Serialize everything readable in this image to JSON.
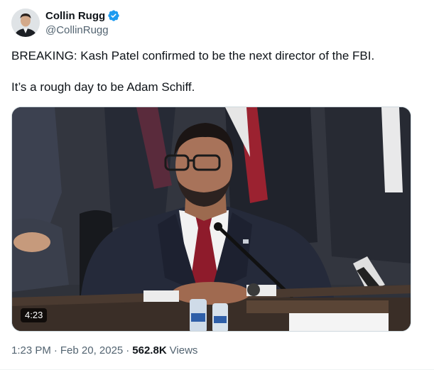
{
  "author": {
    "display_name": "Collin Rugg",
    "handle": "@CollinRugg",
    "verified": true
  },
  "tweet": {
    "paragraphs": [
      "BREAKING: Kash Patel confirmed to be the next director of the FBI.",
      "It’s a rough day to be Adam Schiff."
    ]
  },
  "media": {
    "type": "video",
    "duration": "4:23"
  },
  "meta": {
    "time": "1:23 PM",
    "separator": "·",
    "date": "Feb 20, 2025",
    "views_count": "562.8K",
    "views_label": "Views"
  },
  "colors": {
    "text_primary": "#0f1419",
    "text_secondary": "#536471",
    "verified_blue": "#1d9bf0"
  }
}
